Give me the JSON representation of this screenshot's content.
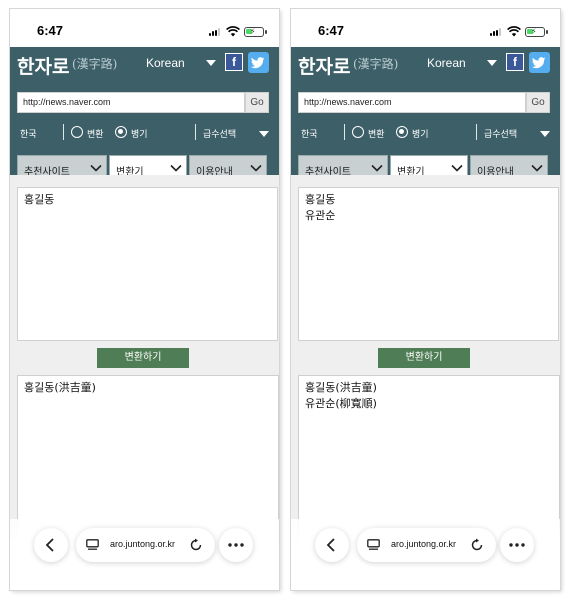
{
  "screens": [
    {
      "status": {
        "time": "6:47"
      },
      "site": {
        "logo_text": "한자로",
        "logo_hanja": "(漢字路)",
        "language": "Korean",
        "url_value": "http://news.naver.com",
        "go_label": "Go",
        "lang_opt": "한국",
        "radio_convert": "변환",
        "radio_both": "병기",
        "grade_select": "급수선택",
        "tabs": [
          "추천사이트",
          "변환기",
          "이용안내"
        ]
      },
      "input_lines": [
        "홍길동"
      ],
      "convert_label": "변환하기",
      "output_lines": [
        "홍길동(洪吉童)"
      ],
      "browser": {
        "url": "aro.juntong.or.kr"
      }
    },
    {
      "status": {
        "time": "6:47"
      },
      "site": {
        "logo_text": "한자로",
        "logo_hanja": "(漢字路)",
        "language": "Korean",
        "url_value": "http://news.naver.com",
        "go_label": "Go",
        "lang_opt": "한국",
        "radio_convert": "변환",
        "radio_both": "병기",
        "grade_select": "급수선택",
        "tabs": [
          "추천사이트",
          "변환기",
          "이용안내"
        ]
      },
      "input_lines": [
        "홍길동",
        "유관순"
      ],
      "convert_label": "변환하기",
      "output_lines": [
        "홍길동(洪吉童)",
        "유관순(柳寬順)"
      ],
      "browser": {
        "url": "aro.juntong.or.kr"
      }
    }
  ],
  "colors": {
    "header_bg": "#3d5f68",
    "convert_button": "#4f7d55",
    "facebook": "#3b5998",
    "twitter": "#55acee"
  },
  "icons": [
    "facebook-icon",
    "twitter-icon",
    "chevron-down-icon",
    "back-icon",
    "reader-icon",
    "reload-icon",
    "more-icon",
    "wifi-icon",
    "battery-icon",
    "signal-icon"
  ]
}
